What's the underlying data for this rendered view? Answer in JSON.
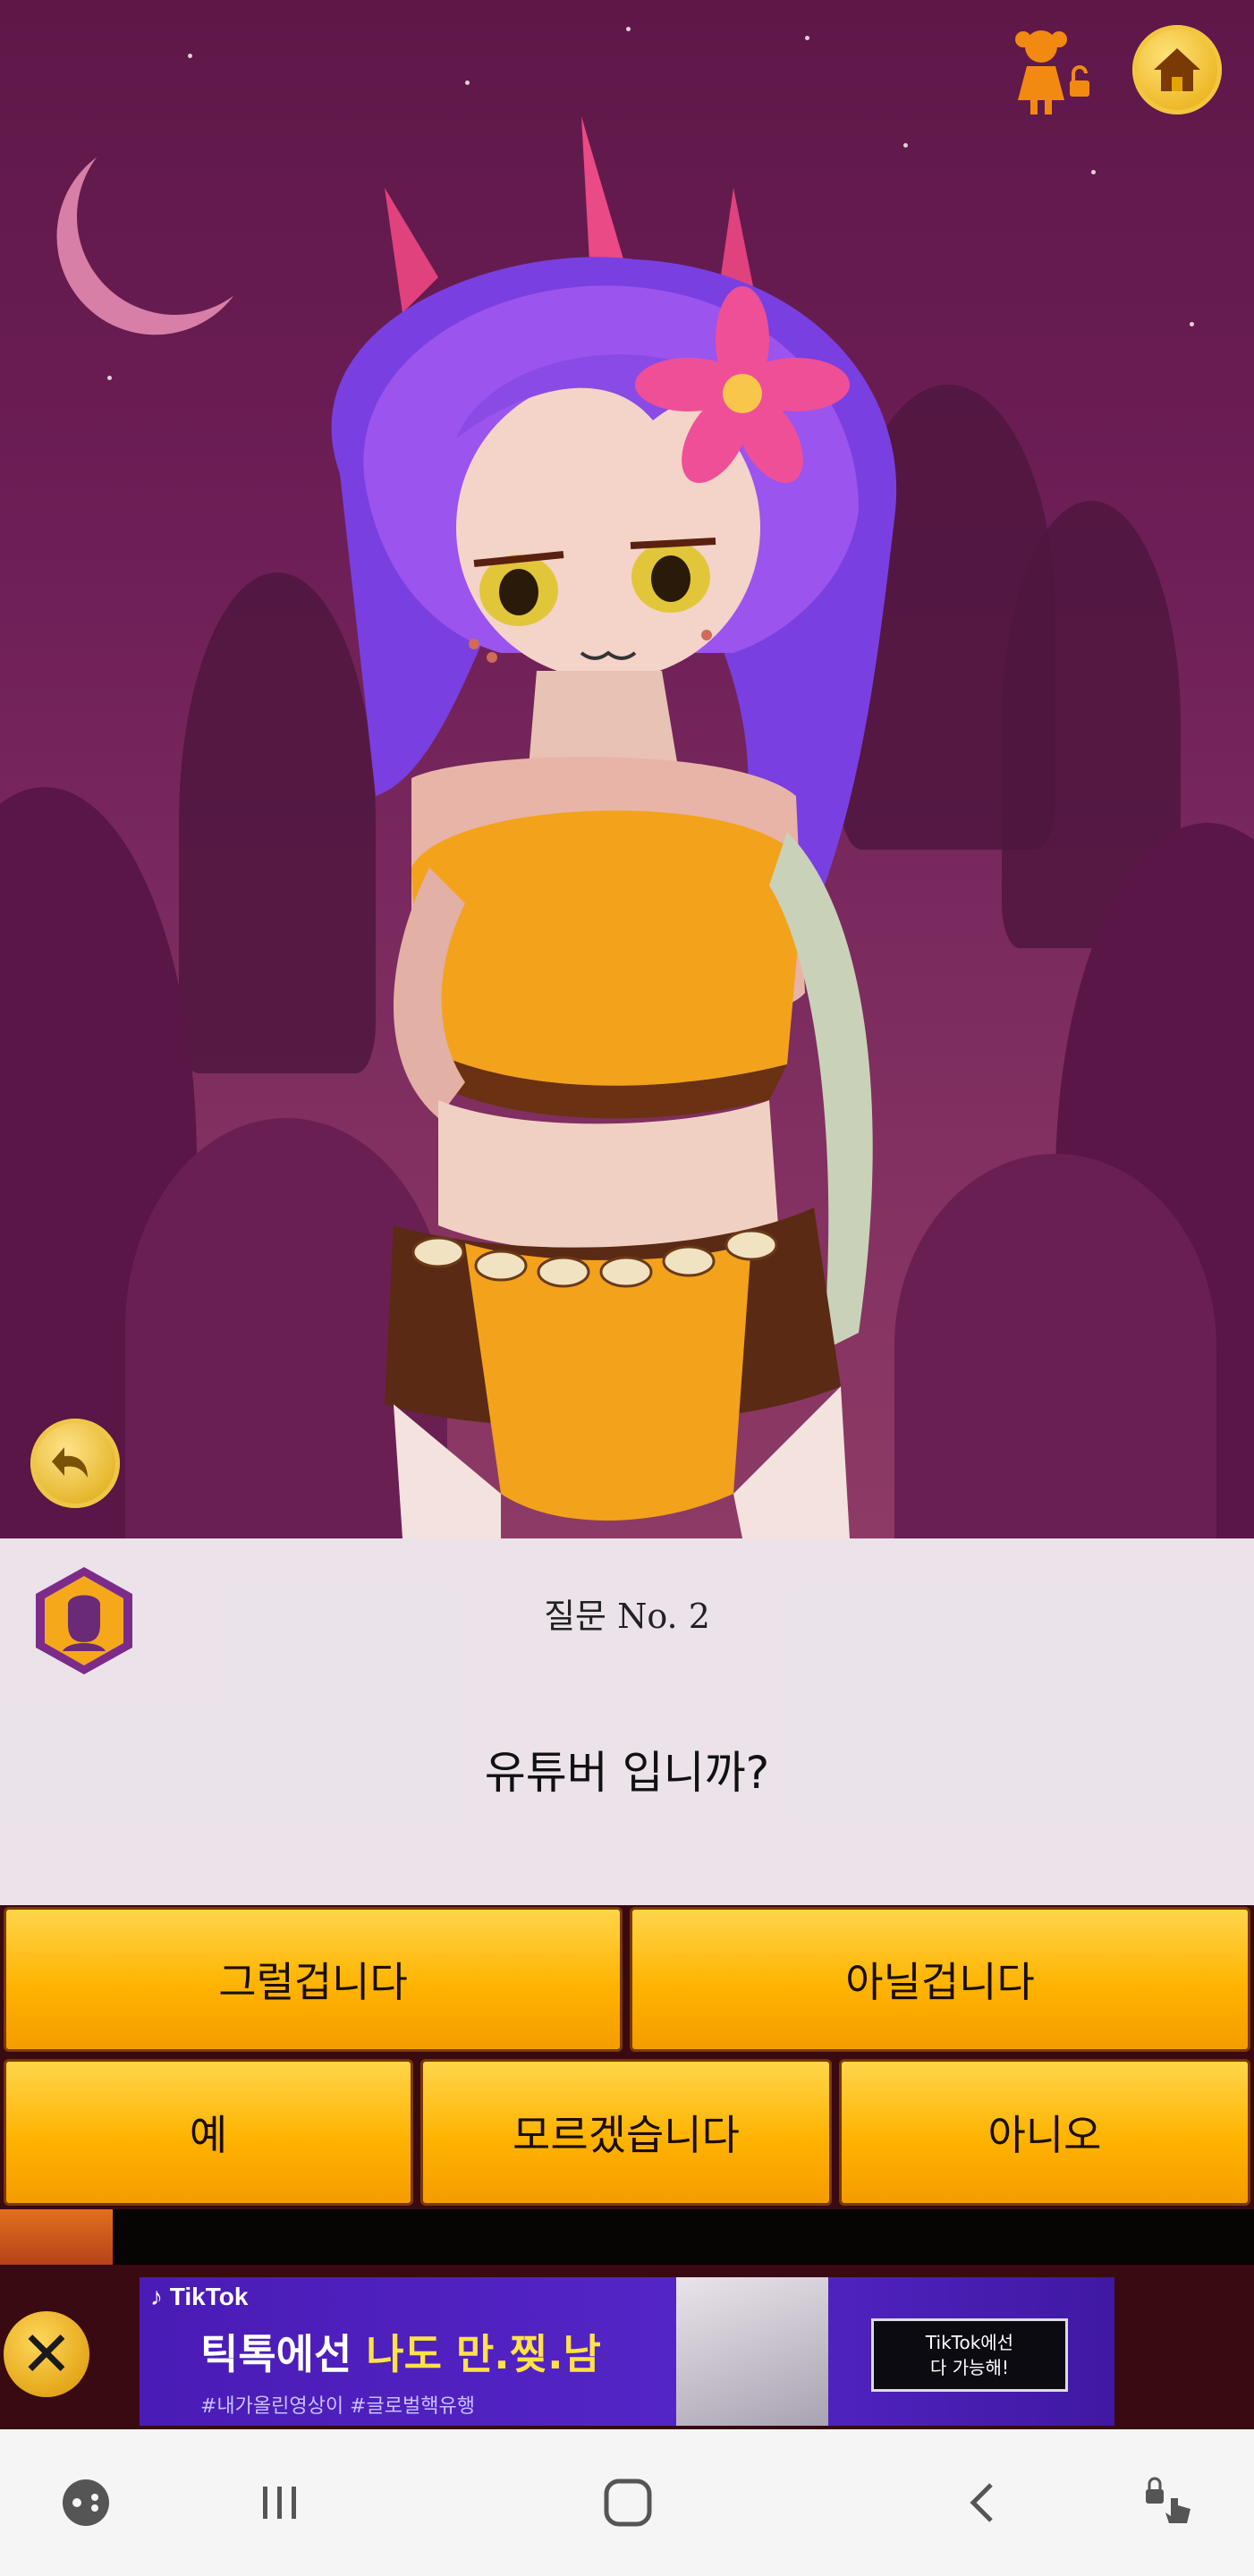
{
  "question": {
    "number_label": "질문 No. 2",
    "text": "유튜버 입니까?"
  },
  "answers": {
    "row1": [
      "그럴겁니다",
      "아닐겁니다"
    ],
    "row2": [
      "예",
      "모르겠습니다",
      "아니오"
    ]
  },
  "progress": {
    "fraction": 0.09
  },
  "ad": {
    "brand": "TikTok",
    "headline_prefix": "틱톡에선 ",
    "headline_highlight": "나도 만.찢.남",
    "subline": "#내가올린영상이 #글로벌핵유행",
    "box_line1": "TikTok에선",
    "box_line2": "다 가능해!"
  },
  "colors": {
    "scene_bg": "#6d1e56",
    "answer_gold": "#ffb300",
    "progress_fill": "#c9521c",
    "ad_purple": "#5526c8"
  },
  "icons": {
    "home": "home-icon",
    "girl_lock": "girl-lock-icon",
    "back": "undo-icon",
    "genie": "genie-badge-icon",
    "ad_close": "close-icon"
  }
}
